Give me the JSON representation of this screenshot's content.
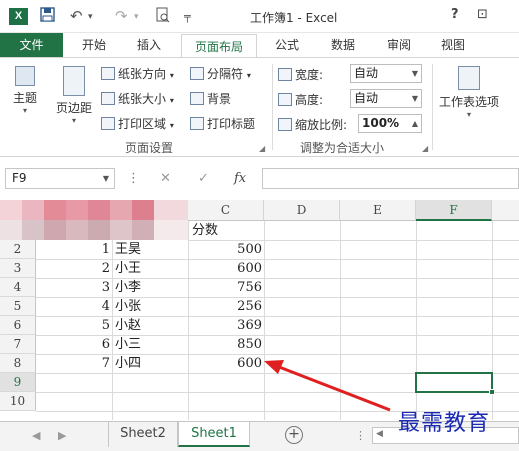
{
  "window": {
    "title": "工作簿1 - Excel",
    "help": "?",
    "restore": "⊡"
  },
  "quick_access": {
    "save": "save-icon",
    "undo": "↶",
    "redo": "↷",
    "preview": "preview-icon",
    "more": "▾"
  },
  "tabs": {
    "file": "文件",
    "items": [
      "开始",
      "插入",
      "页面布局",
      "公式",
      "数据",
      "审阅",
      "视图"
    ],
    "active": "页面布局"
  },
  "ribbon": {
    "theme": "主题",
    "margins": "页边距",
    "orientation": "纸张方向",
    "size": "纸张大小",
    "print_area": "打印区域",
    "breaks": "分隔符",
    "background": "背景",
    "print_titles": "打印标题",
    "group_page_setup": "页面设置",
    "width_label": "宽度:",
    "width_value": "自动",
    "height_label": "高度:",
    "height_value": "自动",
    "scale_label": "缩放比例:",
    "scale_value": "100%",
    "group_scale": "调整为合适大小",
    "sheet_options": "工作表选项"
  },
  "formula_bar": {
    "name_box": "F9",
    "cancel": "✕",
    "enter": "✓",
    "fx": "fx",
    "value": ""
  },
  "columns": [
    "C",
    "D",
    "E",
    "F"
  ],
  "selected_column": "F",
  "rows": [
    {
      "num": "2",
      "a": "1",
      "b": "王昊",
      "c": "500"
    },
    {
      "num": "3",
      "a": "2",
      "b": "小王",
      "c": "600"
    },
    {
      "num": "4",
      "a": "3",
      "b": "小李",
      "c": "756"
    },
    {
      "num": "5",
      "a": "4",
      "b": "小张",
      "c": "256"
    },
    {
      "num": "6",
      "a": "5",
      "b": "小赵",
      "c": "369"
    },
    {
      "num": "7",
      "a": "6",
      "b": "小三",
      "c": "850"
    },
    {
      "num": "8",
      "a": "7",
      "b": "小四",
      "c": "600"
    },
    {
      "num": "9",
      "a": "",
      "b": "",
      "c": ""
    },
    {
      "num": "10",
      "a": "",
      "b": "",
      "c": ""
    }
  ],
  "header_cell_c1": "分数",
  "selected_row": "9",
  "sheets": [
    "Sheet2",
    "Sheet1"
  ],
  "active_sheet": "Sheet1",
  "add_sheet": "⊕",
  "watermark": "最需教育",
  "colors": {
    "excel_green": "#217346",
    "arrow_red": "#e02020",
    "watermark_blue": "#1b2ab3"
  }
}
